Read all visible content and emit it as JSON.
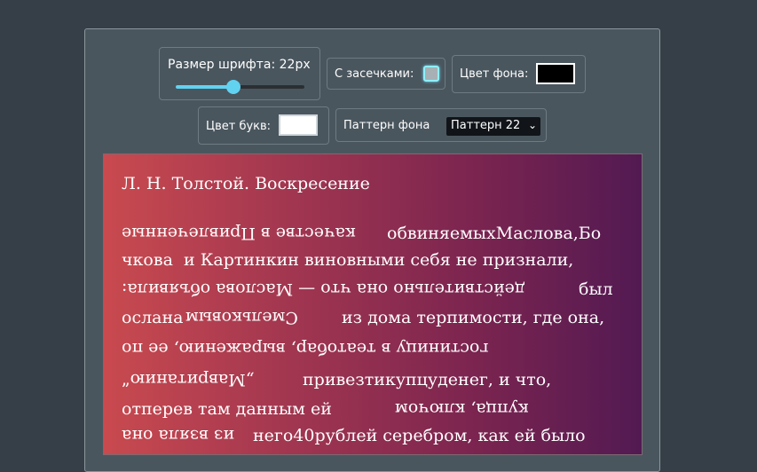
{
  "controls": {
    "font_size_label": "Размер шрифта: 22px",
    "font_size_value": 0.45,
    "serif_label": "С засечками:",
    "serif_checked": false,
    "bg_color_label": "Цвет фона:",
    "bg_color": "#000000",
    "letter_color_label": "Цвет букв:",
    "letter_color": "#ffffff",
    "pattern_label": "Паттерн фона",
    "pattern_selected": "Паттерн 22",
    "accent_color": "#62d2f1"
  },
  "text": {
    "title": "Л. Н. Толстой. Воскресение",
    "lines": [
      {
        "a": "качестве в Привлеченные",
        "a_flip": true,
        "b": "обвиняемыхМаслова,Бо",
        "b_flip": false
      },
      {
        "a": "чкова",
        "a_flip": false,
        "b": "и Картинкин виновными себя не признали,",
        "b_flip": false
      },
      {
        "a": "действительно она что — Маслова объявила:",
        "a_flip": true,
        "b": "был",
        "b_flip": false
      },
      {
        "a": "ослана",
        "a_flip": false,
        "b": "Смельковым",
        "b_flip": true
      },
      {
        "a": "из дома терпимости, где она,",
        "a_flip": false,
        "b": "",
        "b_flip": false
      },
      {
        "a": "гостиницу в театобар, выражению, ее по",
        "a_flip": true,
        "b": "",
        "b_flip": false
      },
      {
        "a": "„Мавританию“",
        "a_flip": true,
        "b": "привезтикупцуденег, и что,",
        "b_flip": false
      },
      {
        "a": "отперев там данным ей",
        "a_flip": false,
        "b": "купца, ключом",
        "b_flip": true
      },
      {
        "a": "из взяла она",
        "a_flip": true,
        "b": "него40рублей серебром, как ей было",
        "b_flip": false
      }
    ]
  }
}
